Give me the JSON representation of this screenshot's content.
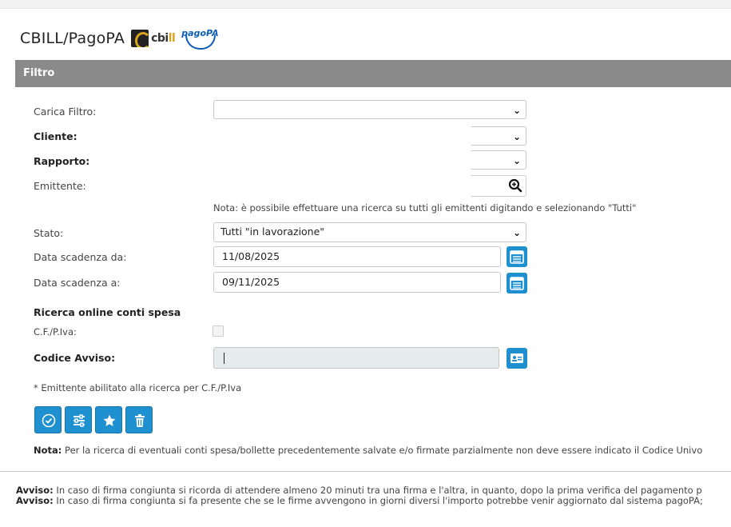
{
  "header": {
    "title": "CBILL/PagoPA",
    "cbill_logo_text_a": "cbi",
    "cbill_logo_text_b": "ll",
    "pagopa_logo_text": "pagoPA"
  },
  "filtro": {
    "section_label": "Filtro",
    "carica_filtro_label": "Carica Filtro:",
    "carica_filtro_value": "",
    "cliente_label": "Cliente:",
    "cliente_value": "",
    "rapporto_label": "Rapporto:",
    "rapporto_value": "",
    "emittente_label": "Emittente:",
    "emittente_value": "",
    "nota_emittente": "Nota: è possibile effettuare una ricerca su tutti gli emittenti digitando e selezionando \"Tutti\"",
    "stato_label": "Stato:",
    "stato_value": "Tutti \"in lavorazione\"",
    "data_da_label": "Data scadenza da:",
    "data_da_value": "11/08/2025",
    "data_a_label": "Data scadenza a:",
    "data_a_value": "09/11/2025"
  },
  "ricerca_online": {
    "section_title": "Ricerca online conti spesa",
    "cf_label": "C.F./P.Iva:",
    "cf_checked": false,
    "codice_label": "Codice Avviso:",
    "codice_value": "",
    "footnote": "* Emittente abilitato alla ricerca per C.F./P.Iva"
  },
  "actions": {
    "buttons": [
      "confirm-icon",
      "sliders-icon",
      "star-icon",
      "trash-icon"
    ]
  },
  "note": {
    "nota_label": "Nota:",
    "nota_text": " Per la ricerca di eventuali conti spesa/bollette precedentemente salvate e/o firmate parzialmente non deve essere indicato il Codice Univo"
  },
  "avvisi": [
    {
      "label": "Avviso:",
      "text": " In caso di firma congiunta si ricorda di attendere almeno 20 minuti tra una firma e l'altra, in quanto, dopo la prima verifica del pagamento p"
    },
    {
      "label": "Avviso:",
      "text": " In caso di firma congiunta si fa presente che se le firme avvengono in giorni diversi l'importo potrebbe venir aggiornato dal sistema pagoPA;"
    }
  ],
  "colors": {
    "accent_blue": "#1e8fcf",
    "filter_bar": "#8a8a8a",
    "cbill_gold": "#d9a520",
    "pagopa_blue": "#0d5db8"
  }
}
